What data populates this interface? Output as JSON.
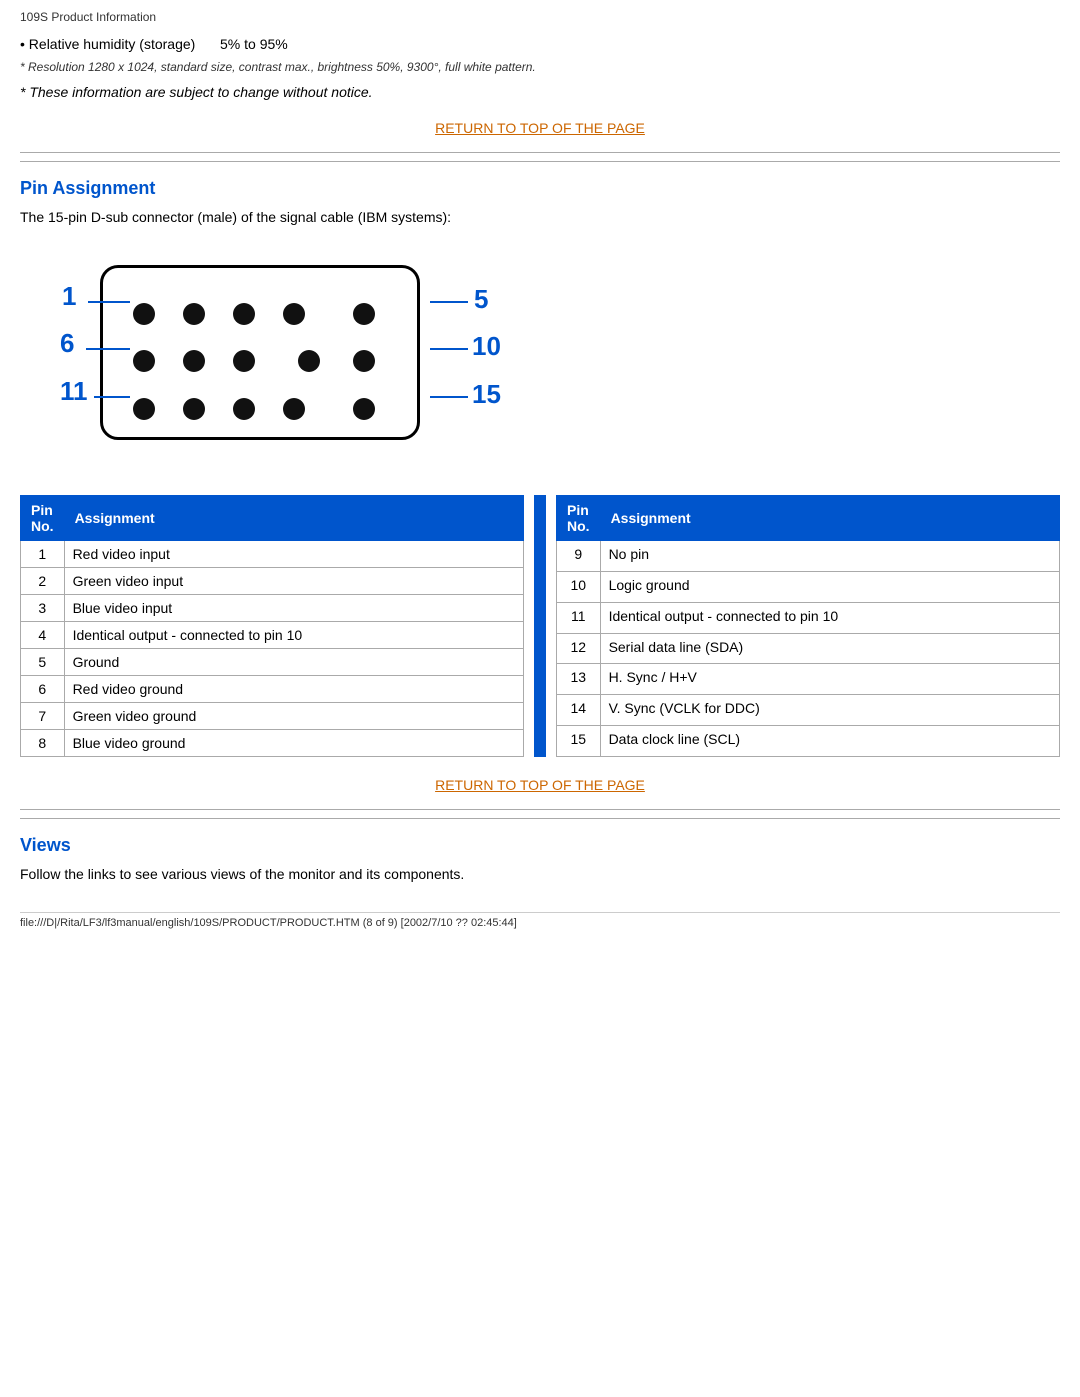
{
  "page": {
    "title": "109S Product Information",
    "spec": {
      "label": "• Relative humidity (storage)",
      "value": "5% to 95%"
    },
    "footnote1": "* Resolution 1280 x 1024, standard size, contrast max., brightness 50%, 9300°, full white pattern.",
    "footnote2": "* These information are subject to change without notice.",
    "return_link": "RETURN TO TOP OF THE PAGE",
    "section_pin": {
      "title": "Pin Assignment",
      "desc": "The 15-pin D-sub connector (male) of the signal cable (IBM systems):",
      "table_left": {
        "headers": [
          "Pin No.",
          "Assignment"
        ],
        "rows": [
          [
            "1",
            "Red video input"
          ],
          [
            "2",
            "Green video input"
          ],
          [
            "3",
            "Blue video input"
          ],
          [
            "4",
            "Identical output - connected to pin 10"
          ],
          [
            "5",
            "Ground"
          ],
          [
            "6",
            "Red video ground"
          ],
          [
            "7",
            "Green video ground"
          ],
          [
            "8",
            "Blue video ground"
          ]
        ]
      },
      "table_right": {
        "headers": [
          "Pin No.",
          "Assignment"
        ],
        "rows": [
          [
            "9",
            "No pin"
          ],
          [
            "10",
            "Logic ground"
          ],
          [
            "11",
            "Identical output - connected to pin 10"
          ],
          [
            "12",
            "Serial data line (SDA)"
          ],
          [
            "13",
            "H. Sync / H+V"
          ],
          [
            "14",
            "V. Sync (VCLK for DDC)"
          ],
          [
            "15",
            "Data clock line (SCL)"
          ]
        ]
      }
    },
    "section_views": {
      "title": "Views",
      "desc": "Follow the links to see various views of the monitor and its components."
    },
    "footer": "file:///D|/Rita/LF3/lf3manual/english/109S/PRODUCT/PRODUCT.HTM (8 of 9) [2002/7/10 ?? 02:45:44]"
  }
}
